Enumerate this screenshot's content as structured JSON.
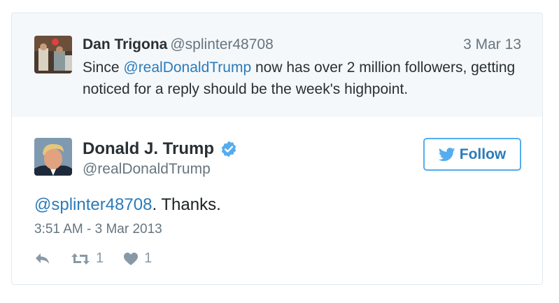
{
  "reply_to": {
    "name": "Dan Trigona",
    "handle": "@splinter48708",
    "date": "3 Mar 13",
    "text_before": "Since ",
    "mention": "@realDonaldTrump",
    "text_after": " now has over 2 million followers, getting noticed for a reply should be the week's highpoint."
  },
  "tweet": {
    "name": "Donald J. Trump",
    "handle": "@realDonaldTrump",
    "follow_label": "Follow",
    "mention": "@splinter48708",
    "text_after": ". Thanks.",
    "timestamp": "3:51 AM - 3 Mar 2013",
    "retweet_count": "1",
    "like_count": "1"
  },
  "colors": {
    "link": "#2b7bb9",
    "verified": "#55acee",
    "muted": "#66757f",
    "reply_bg": "#f5f8fa"
  },
  "icons": [
    "reply-icon",
    "retweet-icon",
    "heart-icon",
    "verified-badge-icon",
    "twitter-bird-icon"
  ]
}
